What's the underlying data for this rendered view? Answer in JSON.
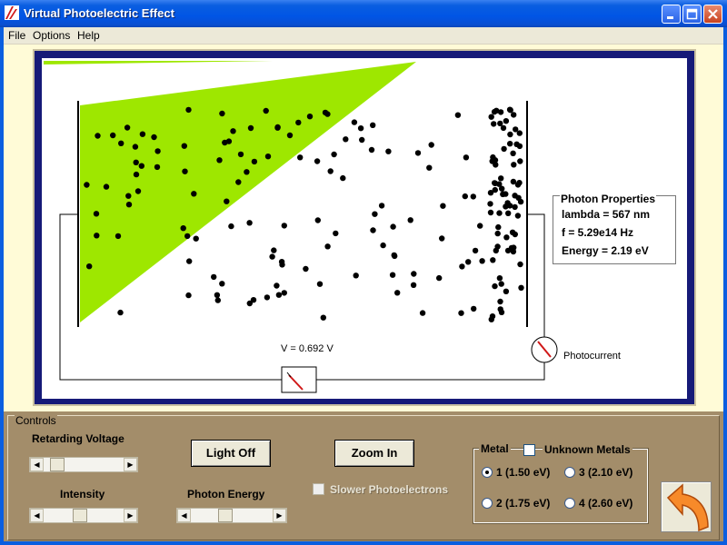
{
  "window": {
    "title": "Virtual Photoelectric Effect"
  },
  "menu": {
    "file": "File",
    "options": "Options",
    "help": "Help"
  },
  "simulation": {
    "voltage_readout": "V = 0.692 V",
    "photocurrent_label": "Photocurrent",
    "light_color": "#9ee700"
  },
  "photon": {
    "header": "Photon Properties",
    "lambda": "lambda = 567 nm",
    "frequency": "f = 5.29e14 Hz",
    "energy": "Energy =  2.19 eV"
  },
  "controls": {
    "group_label": "Controls",
    "retarding_voltage_label": "Retarding Voltage",
    "intensity_label": "Intensity",
    "photon_energy_label": "Photon Energy",
    "light_off_button": "Light Off",
    "zoom_in_button": "Zoom In",
    "slower_photoelectrons_label": "Slower Photoelectrons",
    "retarding_voltage_level": 0.1,
    "intensity_level": 0.45,
    "photon_energy_level": 0.4
  },
  "metal": {
    "title": "Metal",
    "unknown_metals_label": "Unknown Metals",
    "options": [
      {
        "label": "1 (1.50 eV)",
        "selected": true
      },
      {
        "label": "3 (2.10 eV)",
        "selected": false
      },
      {
        "label": "2 (1.75 eV)",
        "selected": false
      },
      {
        "label": "4 (2.60 eV)",
        "selected": false
      }
    ]
  },
  "icons": {
    "app": "app-logo-icon",
    "minimize": "minimize-icon",
    "maximize": "maximize-icon",
    "close": "close-icon",
    "back": "back-arrow-icon"
  }
}
